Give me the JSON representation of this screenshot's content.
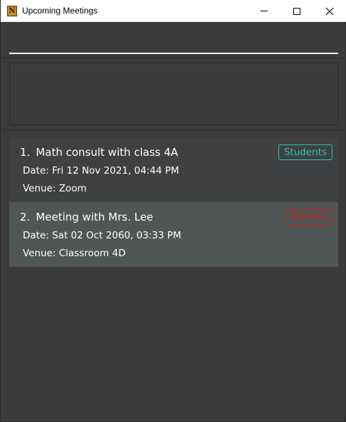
{
  "window": {
    "title": "Upcoming Meetings",
    "app_icon_letter": "N",
    "controls": [
      "minimize",
      "maximize",
      "close"
    ]
  },
  "command_box": {
    "value": ""
  },
  "result_display": {
    "text": ""
  },
  "meetings": [
    {
      "index": "1.",
      "title": "Math consult with class 4A",
      "date": "Date: Fri 12 Nov 2021, 04:44 PM",
      "venue": "Venue: Zoom",
      "tag": "Students",
      "tag_color": "#2ec5b2"
    },
    {
      "index": "2.",
      "title": "Meeting with Mrs. Lee",
      "date": "Date: Sat 02 Oct 2060, 03:33 PM",
      "venue": "Venue: Classroom 4D",
      "tag": "Parents",
      "tag_color": "#d0201c"
    }
  ],
  "colors": {
    "background": "#3b3b3b",
    "card_odd": "#3e4042",
    "card_even": "#505556"
  }
}
